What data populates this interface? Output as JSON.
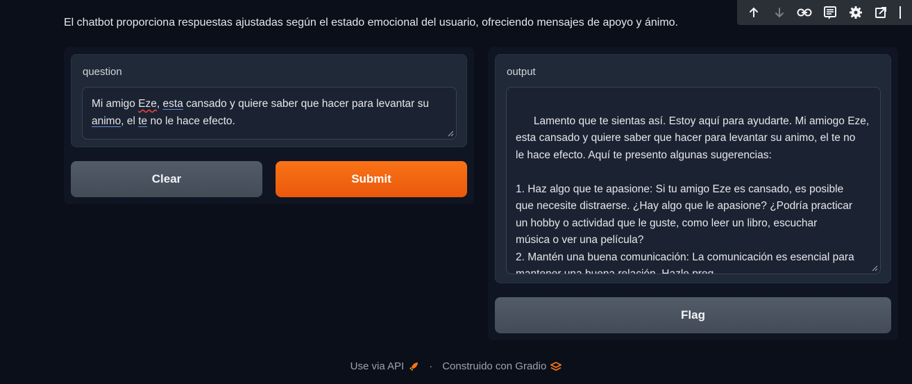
{
  "description": "El chatbot proporciona respuestas ajustadas según el estado emocional del usuario, ofreciendo mensajes de apoyo y ánimo.",
  "toolbar": {
    "icons": [
      "arrow-up-icon",
      "arrow-down-icon",
      "link-icon",
      "notes-icon",
      "gear-icon",
      "open-external-icon",
      "more-vertical-icon"
    ]
  },
  "input": {
    "label": "question",
    "value_part1": "Mi amigo ",
    "value_eze": "Eze",
    "value_comma": ", ",
    "value_esta": "esta",
    "value_part2": " cansado y quiere saber que hacer para levantar su\n",
    "value_animo": "animo",
    "value_part3": ", el ",
    "value_te": "te",
    "value_part4": " no le hace efecto."
  },
  "buttons": {
    "clear": "Clear",
    "submit": "Submit",
    "flag": "Flag"
  },
  "output": {
    "label": "output",
    "value": "Lamento que te sientas así. Estoy aquí para ayudarte. Mi amiogo Eze,\nesta cansado y quiere saber que hacer para levantar su animo, el te no\nle hace efecto. Aquí te presento algunas sugerencias:\n\n1. Haz algo que te apasione: Si tu amigo Eze es cansado, es posible\nque necesite distraerse. ¿Hay algo que le apasione? ¿Podría practicar\nun hobby o actividad que le guste, como leer un libro, escuchar\nmúsica o ver una película?\n2. Mantén una buena comunicación: La comunicación es esencial para\nmantener una buena relación. Hazle preg"
  },
  "footer": {
    "api": "Use via API",
    "separator": "·",
    "built": "Construido con Gradio"
  },
  "colors": {
    "background": "#0b0f19",
    "accent": "#f97316",
    "block": "#1f2937"
  }
}
